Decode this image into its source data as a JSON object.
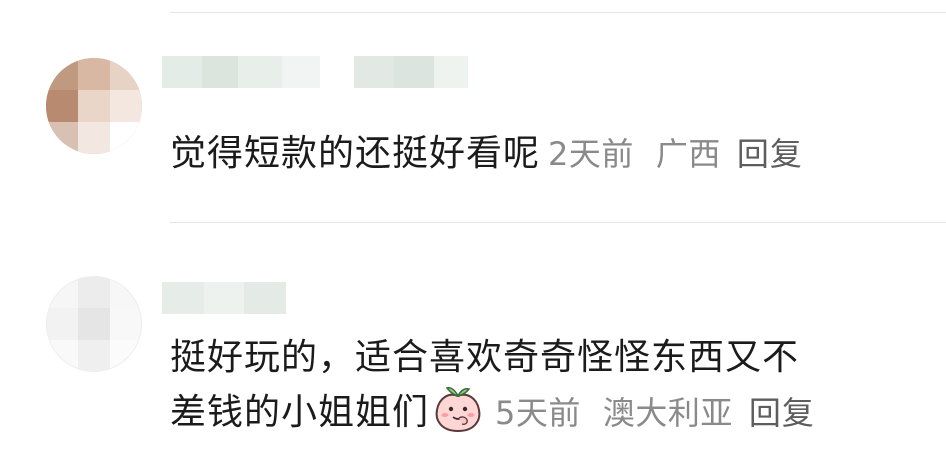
{
  "comments": [
    {
      "text": "觉得短款的还挺好看呢",
      "time": "2天前",
      "location": "广西",
      "reply_label": "回复"
    },
    {
      "text_line1": "挺好玩的，适合喜欢奇奇怪怪东西又不",
      "text_line2": "差钱的小姐姐们",
      "emoji": "peach-emoji",
      "time": "5天前",
      "location": "澳大利亚",
      "reply_label": "回复"
    }
  ]
}
